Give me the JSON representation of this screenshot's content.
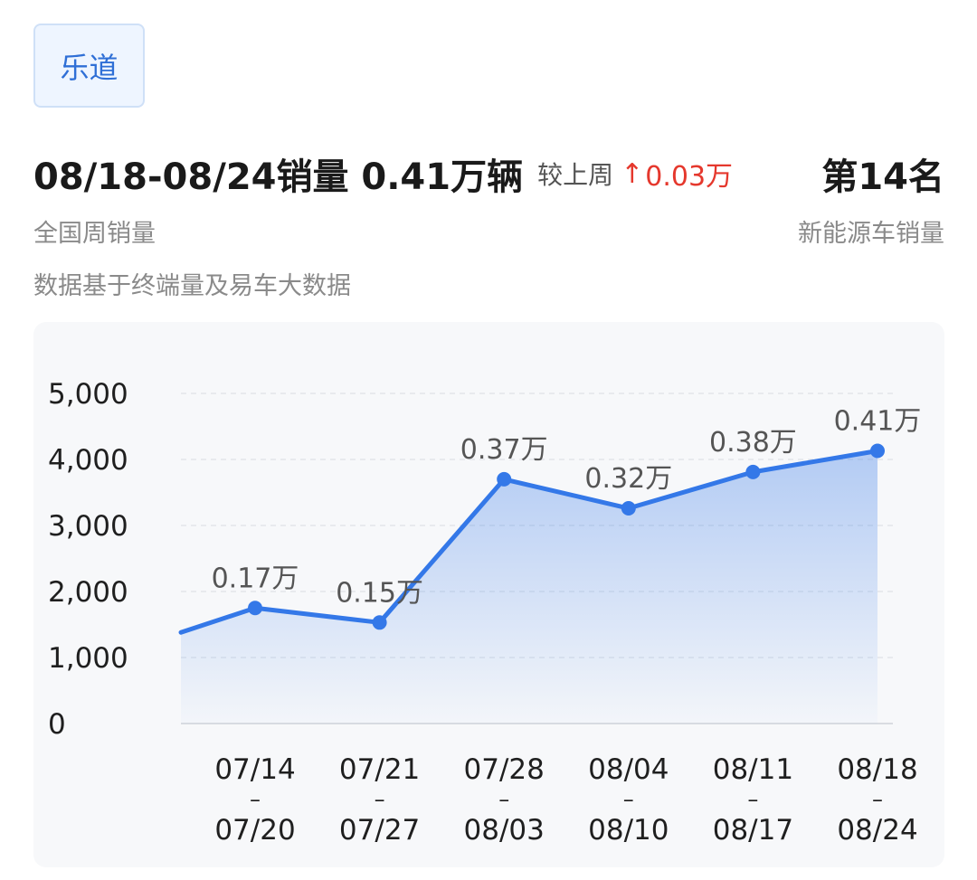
{
  "brand": {
    "name": "乐道"
  },
  "headline": {
    "period_sales": "08/18-08/24销量 0.41万辆",
    "compare_label": "较上周",
    "change_arrow": "↑",
    "change_value": "0.03万",
    "rank": "第14名"
  },
  "subtitles": {
    "left": "全国周销量",
    "right": "新能源车销量",
    "source": "数据基于终端量及易车大数据"
  },
  "colors": {
    "line": "#3478e8",
    "increase": "#e5382d",
    "brand_text": "#2f6fd6"
  },
  "chart_data": {
    "type": "area",
    "title": "",
    "xlabel": "",
    "ylabel": "",
    "ylim": [
      0,
      5000
    ],
    "y_ticks": [
      "5,000",
      "4,000",
      "3,000",
      "2,000",
      "1,000",
      "0"
    ],
    "categories": [
      [
        "07/14",
        "–",
        "07/20"
      ],
      [
        "07/21",
        "–",
        "07/27"
      ],
      [
        "07/28",
        "–",
        "08/03"
      ],
      [
        "08/04",
        "–",
        "08/10"
      ],
      [
        "08/11",
        "–",
        "08/17"
      ],
      [
        "08/18",
        "–",
        "08/24"
      ]
    ],
    "leading_value": 1380,
    "values": [
      1750,
      1530,
      3700,
      3260,
      3810,
      4130
    ],
    "data_labels": [
      "0.17万",
      "0.15万",
      "0.37万",
      "0.32万",
      "0.38万",
      "0.41万"
    ],
    "grid": true
  }
}
